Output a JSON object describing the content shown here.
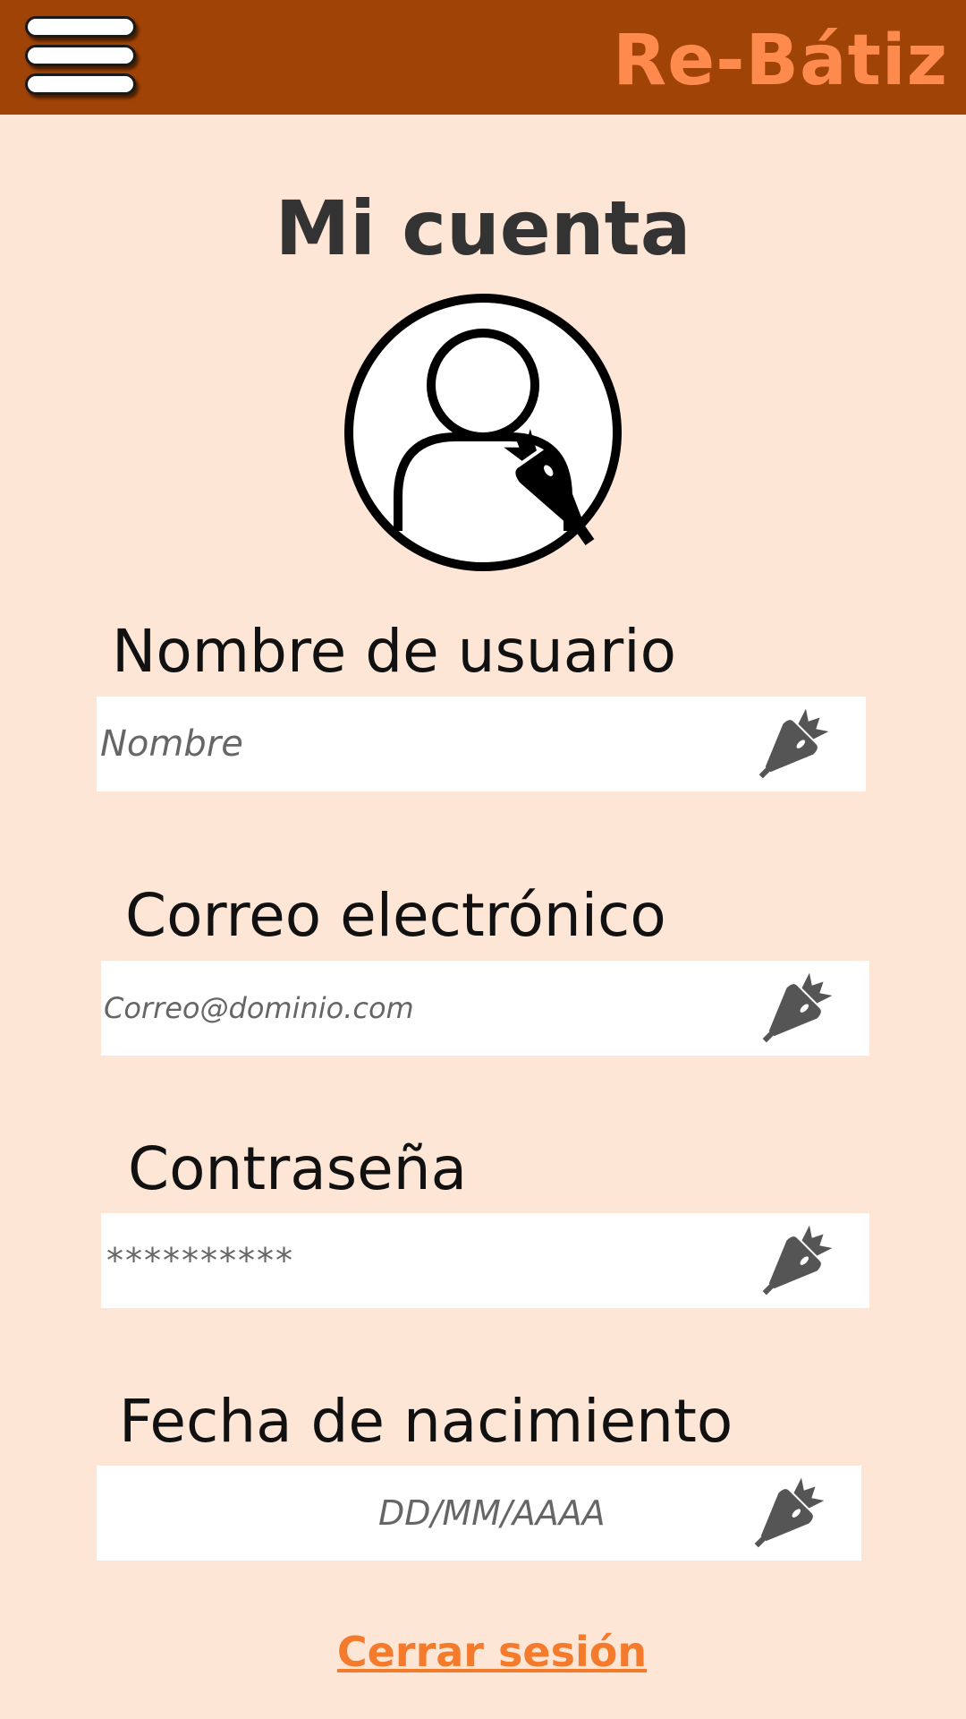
{
  "header": {
    "brand": "Re-Bátiz",
    "menu_icon": "hamburger-menu-icon",
    "colors": {
      "bar": "#9f4307",
      "brand": "#fe8a4d"
    }
  },
  "page": {
    "title": "Mi cuenta",
    "background": "#fee6d6",
    "avatar_icon": "user-avatar-with-piping-bag-icon"
  },
  "fields": [
    {
      "label": "Nombre de usuario",
      "value": "Nombre",
      "edit_icon": "piping-bag-edit-icon"
    },
    {
      "label": "Correo electrónico",
      "value": "Correo@dominio.com",
      "edit_icon": "piping-bag-edit-icon"
    },
    {
      "label": "Contraseña",
      "value": "**********",
      "edit_icon": "piping-bag-edit-icon"
    },
    {
      "label": "Fecha de nacimiento",
      "value": "DD/MM/AAAA",
      "edit_icon": "piping-bag-edit-icon"
    }
  ],
  "footer": {
    "logout_label": "Cerrar sesión",
    "logout_color": "#f47a2c"
  }
}
